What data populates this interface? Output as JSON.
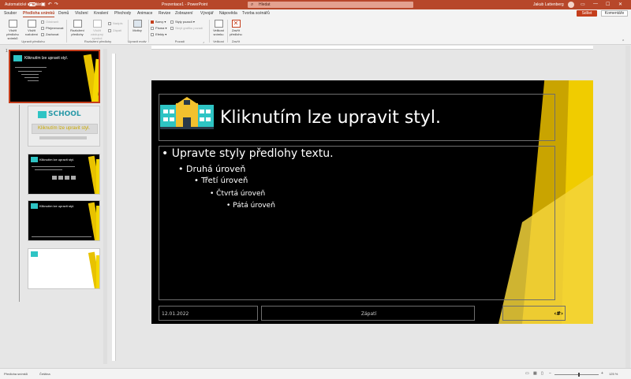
{
  "titlebar": {
    "autosave_label": "Automatické ukládání",
    "qat_icons": "save-icon undo-icon redo-icon",
    "doc_title": "Prezentace1 - PowerPoint",
    "search_placeholder": "Hledat",
    "user_name": "Jakub Lattenberg",
    "brand_color": "#b7472a"
  },
  "tabs": {
    "items": [
      "Soubor",
      "Předloha snímků",
      "Domů",
      "Vložení",
      "Kreslení",
      "Přechody",
      "Animace",
      "Revize",
      "Zobrazení",
      "Vývojář",
      "Nápověda",
      "Tvorba scénářů"
    ],
    "active_index": 1,
    "share_label": "Sdílet",
    "comments_label": "Komentáře"
  },
  "ribbon": {
    "insert_slide_master": "Vložit předlohu snímků",
    "insert_layout": "Vložit rozložení",
    "delete_label": "Odstranit",
    "rename_label": "Přejmenovat",
    "preserve_label": "Zachovat",
    "group_edit_master": "Upravit předlohu",
    "master_layout_label": "Rozložení předlohy",
    "insert_placeholder_label": "Vložit zástupný symbol",
    "title_check": "Nadpis",
    "footers_check": "Zápatí",
    "group_master_layout": "Rozložení předlohy",
    "themes_label": "Motivy",
    "group_edit_theme": "Upravit motiv",
    "colors_label": "Barvy",
    "fonts_label": "Písma",
    "effects_label": "Efekty",
    "bg_styles_label": "Styly pozadí",
    "hide_bg_label": "Skrýt grafiku pozadí",
    "group_background": "Pozadí",
    "slide_size_label": "Velikost snímku",
    "group_size": "Velikost",
    "close_master_label": "Zavřít předlohu",
    "group_close": "Zavřít"
  },
  "thumbnails": {
    "master_number": "1",
    "master_title": "Kliknutím lze upravit styl.",
    "school_title": "SCHOOL",
    "school_subtitle": "Kliknutím lze upravit styl.",
    "layout3_title": "Kliknutím lze upravit styl.",
    "layout4_title": "Kliknutím lze upravit styl."
  },
  "slide": {
    "title": "Kliknutím lze upravit styl.",
    "bullets": [
      "• Upravte styly předlohy textu.",
      "• Druhá úroveň",
      "• Třetí úroveň",
      "• Čtvrtá úroveň",
      "• Pátá úroveň"
    ],
    "date": "12.01.2022",
    "footer": "Zápatí",
    "slide_number": "‹#›",
    "accent_color": "#e8c200"
  },
  "statusbar": {
    "view_label": "Předloha snímků",
    "language": "Čeština",
    "zoom_level": "125 %"
  }
}
